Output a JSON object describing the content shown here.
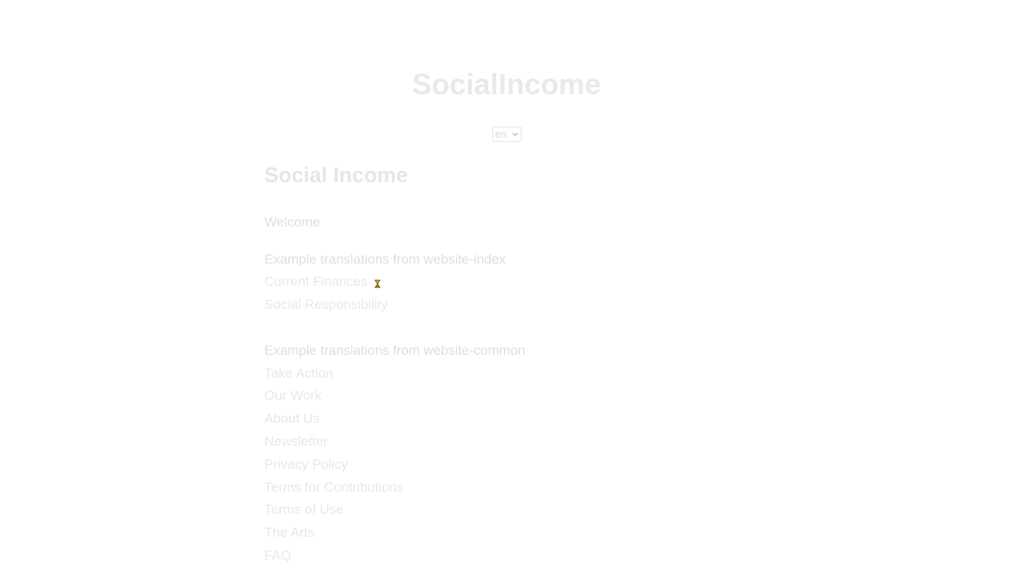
{
  "header": {
    "site_title": "SocialIncome",
    "language_select": {
      "value": "en"
    }
  },
  "main": {
    "title": "Social Income",
    "welcome": "Welcome",
    "index_section": {
      "heading": "Example translations from website-index",
      "links": [
        "Current Finances",
        "Social Responsibility"
      ]
    },
    "common_section": {
      "heading": "Example translations from website-common",
      "links": [
        "Take Action",
        "Our Work",
        "About Us",
        "Newsletter",
        "Privacy Policy",
        "Terms for Contributions",
        "Terms of Use",
        "The Arts",
        "FAQ"
      ]
    }
  },
  "icons": {
    "cursor": "busy-cursor-icon",
    "select_arrow": "chevron-down-icon"
  },
  "colors": {
    "cursor_yellow": "#f2d21b"
  }
}
